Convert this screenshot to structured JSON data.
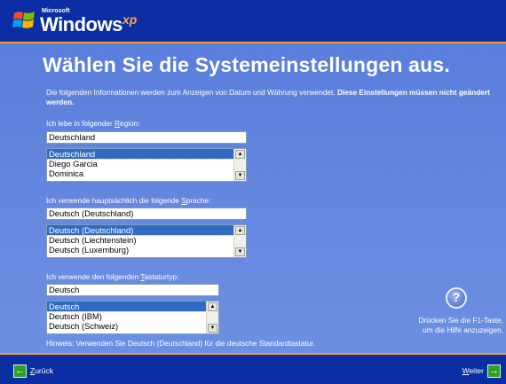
{
  "header": {
    "brand_small": "Microsoft",
    "brand": "Windows",
    "brand_suffix": "xp"
  },
  "title": "Wählen Sie die Systemeinstellungen aus.",
  "intro": {
    "text": "Die folgenden Informationen werden zum Anzeigen von Datum und Währung verwendet.",
    "bold": "Diese Einstellungen müssen nicht geändert werden."
  },
  "region": {
    "label_prefix": "Ich lebe in folgender ",
    "label_key": "R",
    "label_suffix": "egion:",
    "value": "Deutschland",
    "options": [
      "Deutschland",
      "Diego Garcia",
      "Dominica"
    ],
    "selected_index": 0
  },
  "language": {
    "label_prefix": "Ich verwende hauptsächlich die folgende ",
    "label_key": "S",
    "label_suffix": "prache:",
    "value": "Deutsch (Deutschland)",
    "options": [
      "Deutsch (Deutschland)",
      "Deutsch (Liechtenstein)",
      "Deutsch (Luxemburg)"
    ],
    "selected_index": 0
  },
  "keyboard": {
    "label_prefix": "Ich verwende den folgenden ",
    "label_key": "T",
    "label_suffix": "astaturtyp:",
    "value": "Deutsch",
    "options": [
      "Deutsch",
      "Deutsch (IBM)",
      "Deutsch (Schweiz)"
    ],
    "selected_index": 0
  },
  "hint": "Hinweis: Verwenden Sie Deutsch (Deutschland) für die deutsche Standardtastatur.",
  "help": {
    "icon": "?",
    "line1": "Drücken Sie die F1-Taste,",
    "line2": "um die Hilfe anzuzeigen."
  },
  "footer": {
    "back_key": "Z",
    "back_rest": "urück",
    "next_key": "W",
    "next_rest": "eiter"
  },
  "colors": {
    "bar": "#0b2ea5",
    "accent": "#f49a31",
    "panel": "#5a7edc",
    "selection": "#316ac5",
    "arrow": "#2ea02a"
  }
}
